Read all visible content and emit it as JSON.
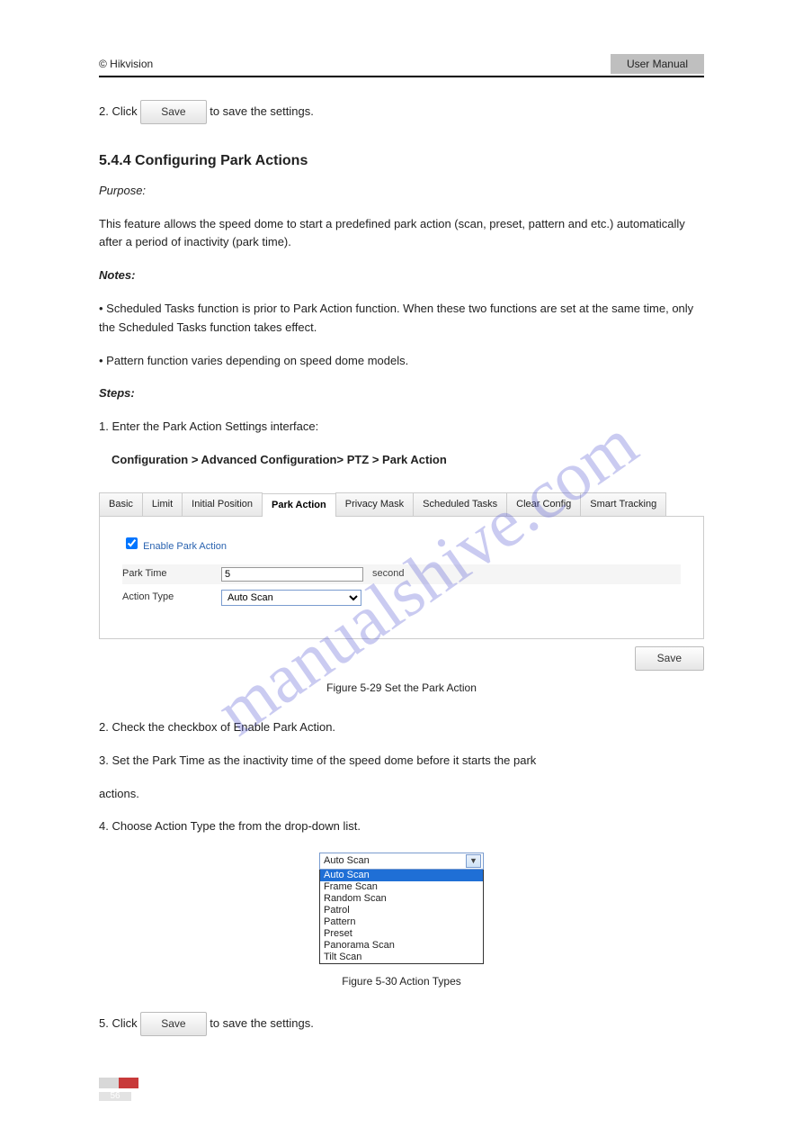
{
  "header": {
    "left": "© Hikvision",
    "right": "User Manual"
  },
  "text": {
    "p1_pre": "2. Click ",
    "save_label": "Save",
    "p1_post": " to save the settings.",
    "section_title": "5.4.4 Configuring Park Actions",
    "purpose_title": "Purpose:",
    "purpose_body": "This feature allows the speed dome to start a predefined park action (scan, preset, pattern and etc.) automatically after a period of inactivity (park time).",
    "notes_title": "Notes:",
    "note1": "Scheduled Tasks function is prior to Park Action function. When these two functions are set at the same time, only the Scheduled Tasks function takes effect.",
    "note2": "Pattern function varies depending on speed dome models.",
    "steps_title": "Steps:",
    "step1": "1. Enter the Park Action Settings interface:",
    "step1_path": "Configuration > Advanced Configuration> PTZ > Park Action",
    "figure1_caption": "Figure 5-29 Set the Park Action",
    "step2": "2. Check the checkbox of Enable Park Action.",
    "step3_pre": "3. Set the Park Time as the inactivity time of the speed dome before it starts the park",
    "step3_post": "actions.",
    "step4": "4. Choose Action Type the from the drop-down list.",
    "figure2_caption": "Figure 5-30 Action Types",
    "step5_pre": "5. Click ",
    "step5_post": " to save the settings.",
    "page_number": "56"
  },
  "ui": {
    "tabs": [
      "Basic",
      "Limit",
      "Initial Position",
      "Park Action",
      "Privacy Mask",
      "Scheduled Tasks",
      "Clear Config",
      "Smart Tracking"
    ],
    "active_tab": "Park Action",
    "enable_label": "Enable Park Action",
    "park_time_label": "Park Time",
    "park_time_value": "5",
    "park_time_unit": "second",
    "action_type_label": "Action Type",
    "action_type_value": "Auto Scan",
    "save_label": "Save"
  },
  "dropdown": {
    "selected": "Auto Scan",
    "items": [
      "Auto Scan",
      "Frame Scan",
      "Random Scan",
      "Patrol",
      "Pattern",
      "Preset",
      "Panorama Scan",
      "Tilt Scan"
    ]
  },
  "watermark": "manualshive.com"
}
